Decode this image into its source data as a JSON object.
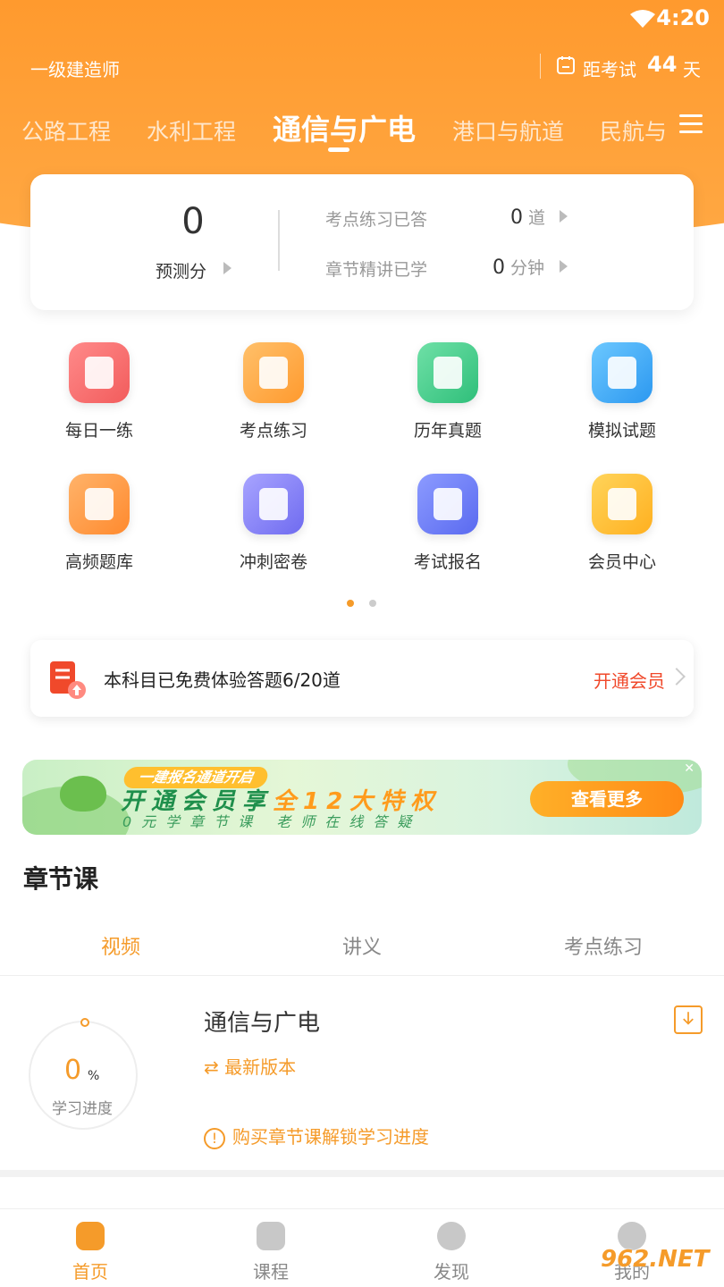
{
  "status_bar": {
    "time": "4:20"
  },
  "header": {
    "subject": "一级建造师",
    "exam_label": "距考试",
    "exam_days": "44",
    "exam_unit": "天"
  },
  "tabs": [
    {
      "label": "公路工程",
      "active": false
    },
    {
      "label": "水利工程",
      "active": false
    },
    {
      "label": "通信与广电",
      "active": true
    },
    {
      "label": "港口与航道",
      "active": false
    },
    {
      "label": "民航与",
      "active": false
    }
  ],
  "stats": {
    "score_value": "0",
    "score_label": "预测分",
    "practice_label": "考点练习已答",
    "practice_value": "0",
    "practice_unit": "道",
    "chapter_label": "章节精讲已学",
    "chapter_value": "0",
    "chapter_unit": "分钟"
  },
  "grid": [
    {
      "label": "每日一练",
      "icon": "calendar-check-icon",
      "color_a": "#ff8a8a",
      "color_b": "#f25c5c"
    },
    {
      "label": "考点练习",
      "icon": "lightning-card-icon",
      "color_a": "#ffc06a",
      "color_b": "#ff9a2e"
    },
    {
      "label": "历年真题",
      "icon": "document-leaf-icon",
      "color_a": "#6fe0a7",
      "color_b": "#2fbf7a"
    },
    {
      "label": "模拟试题",
      "icon": "monitor-chart-icon",
      "color_a": "#6cc8ff",
      "color_b": "#2c98f0"
    },
    {
      "label": "高频题库",
      "icon": "scroll-pulse-icon",
      "color_a": "#ffb36a",
      "color_b": "#ff8a2e"
    },
    {
      "label": "冲刺密卷",
      "icon": "book-bookmark-icon",
      "color_a": "#a8a4ff",
      "color_b": "#6f6bf0"
    },
    {
      "label": "考试报名",
      "icon": "pen-form-icon",
      "color_a": "#8c9bff",
      "color_b": "#5a6af0"
    },
    {
      "label": "会员中心",
      "icon": "crown-icon",
      "color_a": "#ffd45a",
      "color_b": "#ffb020"
    }
  ],
  "pager": {
    "active_color": "#f59b2a",
    "inactive_color": "#cccccc"
  },
  "trial": {
    "text": "本科目已免费体验答题6/20道",
    "link": "开通会员"
  },
  "banner": {
    "tag": "一建报名通道开启",
    "main_prefix": "开通会员享",
    "main_highlight": "全12大特权",
    "sub": "0元学章节课  老师在线答疑",
    "button": "查看更多",
    "close": "✕"
  },
  "section": {
    "title": "章节课"
  },
  "subtabs": [
    {
      "label": "视频",
      "active": true
    },
    {
      "label": "讲义",
      "active": false
    },
    {
      "label": "考点练习",
      "active": false
    }
  ],
  "course": {
    "progress_value": "0",
    "progress_unit": "%",
    "progress_label": "学习进度",
    "progress": 0,
    "title": "通信与广电",
    "version_icon": "⇄",
    "version": "最新版本",
    "notice_icon": "!",
    "notice": "购买章节课解锁学习进度"
  },
  "bottom_nav": [
    {
      "label": "首页",
      "icon": "home-icon",
      "active": true
    },
    {
      "label": "课程",
      "icon": "course-doc-icon",
      "active": false
    },
    {
      "label": "发现",
      "icon": "compass-icon",
      "active": false
    },
    {
      "label": "我的",
      "icon": "profile-icon",
      "active": false
    }
  ],
  "watermark": "962.NET",
  "accent_color": "#f59b2a"
}
